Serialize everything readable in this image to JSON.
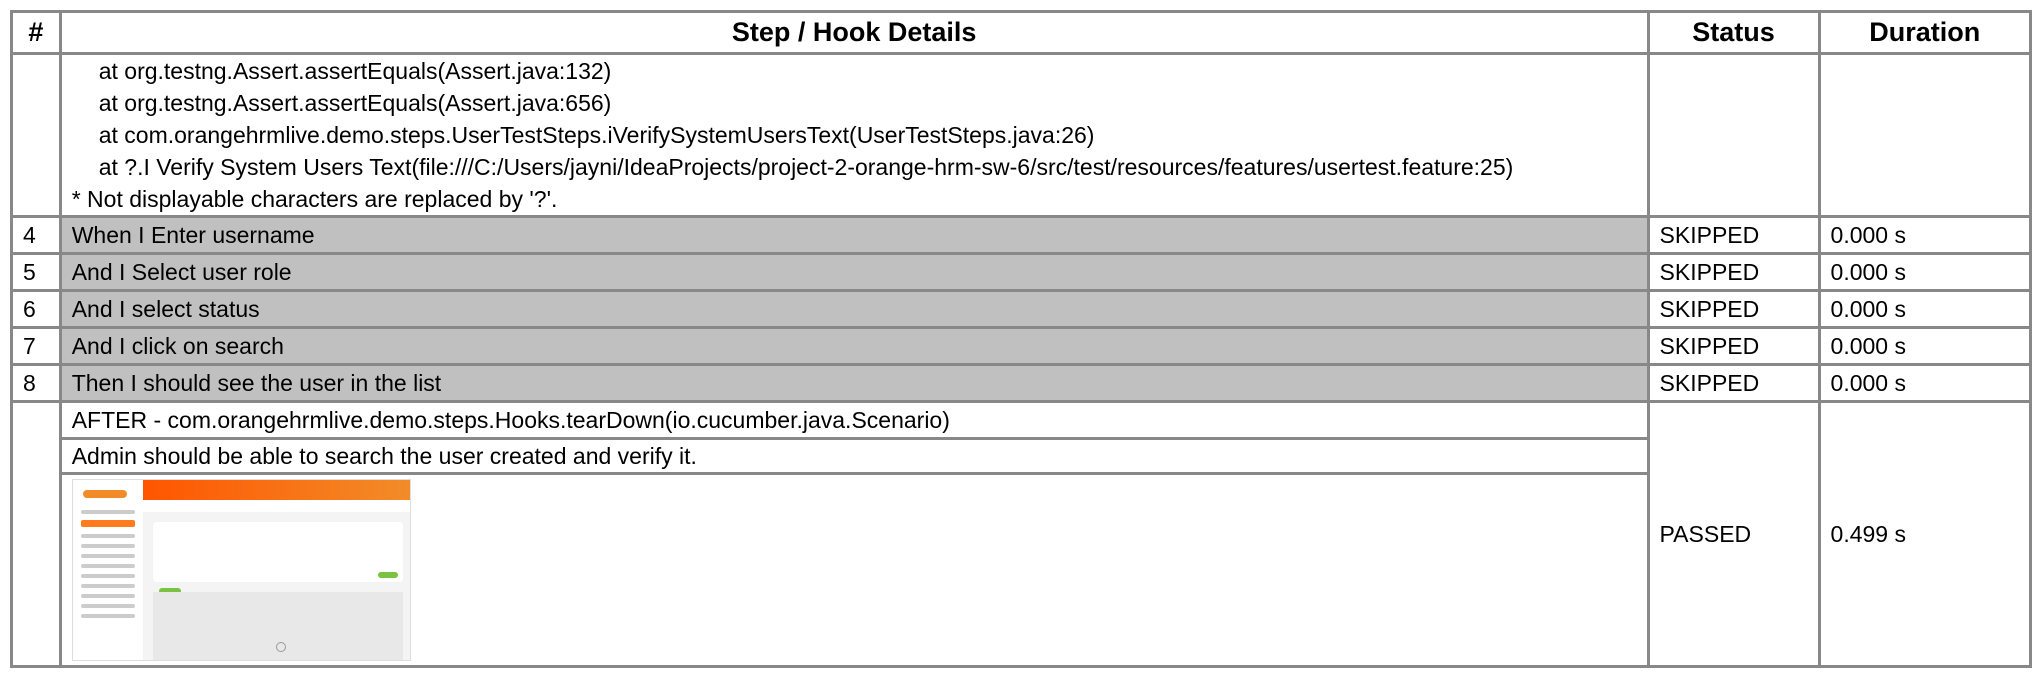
{
  "headers": {
    "num": "#",
    "step": "Step / Hook Details",
    "status": "Status",
    "duration": "Duration"
  },
  "error": {
    "lines": [
      "at org.testng.Assert.assertEquals(Assert.java:132)",
      "at org.testng.Assert.assertEquals(Assert.java:656)",
      "at com.orangehrmlive.demo.steps.UserTestSteps.iVerifySystemUsersText(UserTestSteps.java:26)",
      "at ?.I Verify System Users Text(file:///C:/Users/jayni/IdeaProjects/project-2-orange-hrm-sw-6/src/test/resources/features/usertest.feature:25)"
    ],
    "note": "* Not displayable characters are replaced by '?'."
  },
  "steps": [
    {
      "num": "4",
      "text": "When I Enter username",
      "status": "SKIPPED",
      "duration": "0.000 s"
    },
    {
      "num": "5",
      "text": "And I Select user role",
      "status": "SKIPPED",
      "duration": "0.000 s"
    },
    {
      "num": "6",
      "text": "And I select status",
      "status": "SKIPPED",
      "duration": "0.000 s"
    },
    {
      "num": "7",
      "text": "And I click on search",
      "status": "SKIPPED",
      "duration": "0.000 s"
    },
    {
      "num": "8",
      "text": "Then I should see the user in the list",
      "status": "SKIPPED",
      "duration": "0.000 s"
    }
  ],
  "after_hook": {
    "text": "AFTER - com.orangehrmlive.demo.steps.Hooks.tearDown(io.cucumber.java.Scenario)",
    "status": "PASSED",
    "duration": "0.499 s",
    "scenario_name": "Admin should be able to search the user created and verify it."
  },
  "colors": {
    "skipped": "#f5c400",
    "passed": "#22dd22",
    "error": "#ff0000",
    "step_bg": "#c0c0c0",
    "border": "#888888"
  }
}
